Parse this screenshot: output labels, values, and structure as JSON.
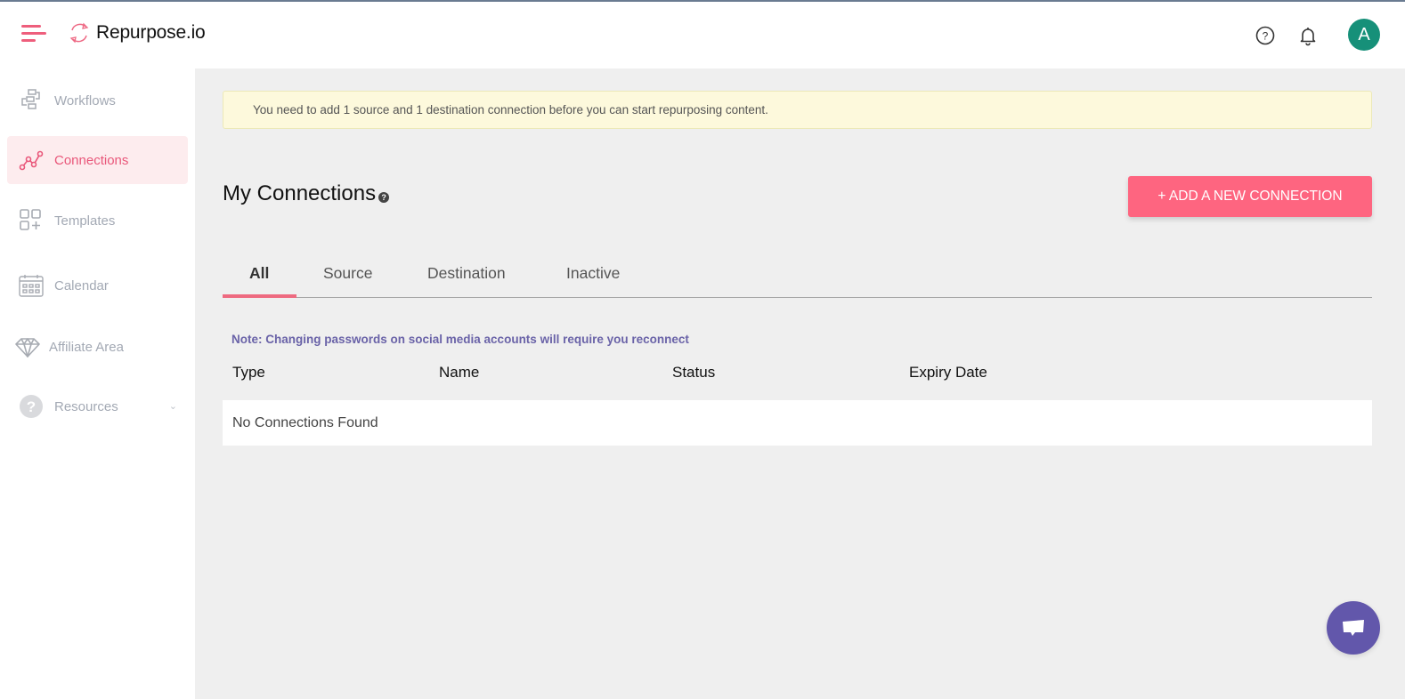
{
  "header": {
    "brand": "Repurpose.io",
    "avatar_initial": "A",
    "brand_color": "#ee5e7c",
    "avatar_color": "#169079"
  },
  "sidebar": {
    "items": [
      {
        "label": "Workflows",
        "icon": "workflows-icon",
        "active": false
      },
      {
        "label": "Connections",
        "icon": "connections-icon",
        "active": true
      },
      {
        "label": "Templates",
        "icon": "templates-icon",
        "active": false
      },
      {
        "label": "Calendar",
        "icon": "calendar-icon",
        "active": false
      },
      {
        "label": "Affiliate Area",
        "icon": "diamond-icon",
        "active": false
      },
      {
        "label": "Resources",
        "icon": "question-circle-icon",
        "active": false,
        "has_dropdown": true
      }
    ]
  },
  "main": {
    "alert": "You need to add 1 source and 1 destination connection before you can start repurposing content.",
    "title": "My Connections",
    "add_button": "+ ADD A NEW CONNECTION",
    "tabs": [
      {
        "label": "All",
        "active": true
      },
      {
        "label": "Source",
        "active": false
      },
      {
        "label": "Destination",
        "active": false
      },
      {
        "label": "Inactive",
        "active": false
      }
    ],
    "note": "Note: Changing passwords on social media accounts will require you reconnect",
    "table": {
      "columns": [
        "Type",
        "Name",
        "Status",
        "Expiry Date"
      ],
      "empty_message": "No Connections Found"
    }
  }
}
